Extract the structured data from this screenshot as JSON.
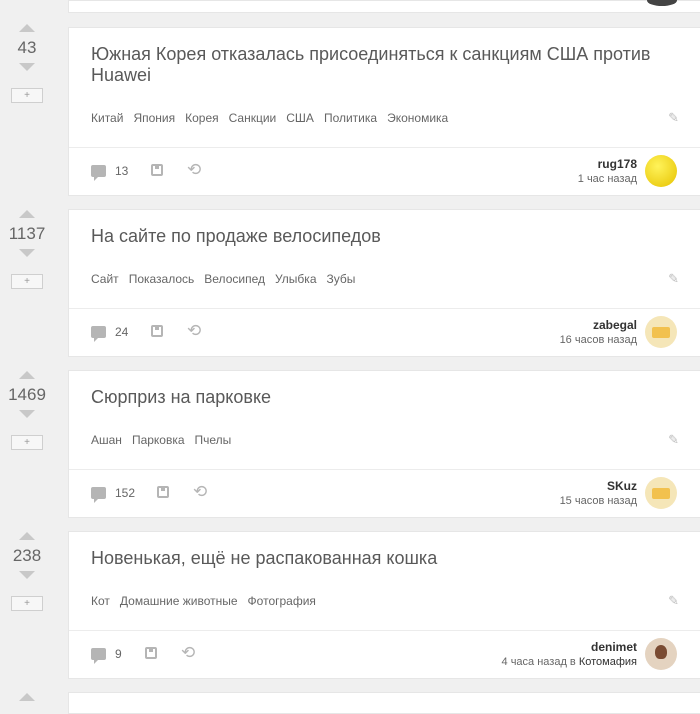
{
  "posts": [
    {
      "score": "43",
      "title": "Южная Корея отказалась присоединяться к санкциям США против Huawei",
      "tags": [
        "Китай",
        "Япония",
        "Корея",
        "Санкции",
        "США",
        "Политика",
        "Экономика"
      ],
      "comments": "13",
      "author": "rug178",
      "time": "1 час назад",
      "community": ""
    },
    {
      "score": "1137",
      "title": "На сайте по продаже велосипедов",
      "tags": [
        "Сайт",
        "Показалось",
        "Велосипед",
        "Улыбка",
        "Зубы"
      ],
      "comments": "24",
      "author": "zabegal",
      "time": "16 часов назад",
      "community": ""
    },
    {
      "score": "1469",
      "title": "Сюрприз на парковке",
      "tags": [
        "Ашан",
        "Парковка",
        "Пчелы"
      ],
      "comments": "152",
      "author": "SKuz",
      "time": "15 часов назад",
      "community": ""
    },
    {
      "score": "238",
      "title": "Новенькая, ещё не распакованная кошка",
      "tags": [
        "Кот",
        "Домашние животные",
        "Фотография"
      ],
      "comments": "9",
      "author": "denimet",
      "time": "4 часа назад в ",
      "community": "Котомафия"
    }
  ],
  "icons": {
    "plus": "+",
    "edit": "✎",
    "share": "⟲"
  }
}
